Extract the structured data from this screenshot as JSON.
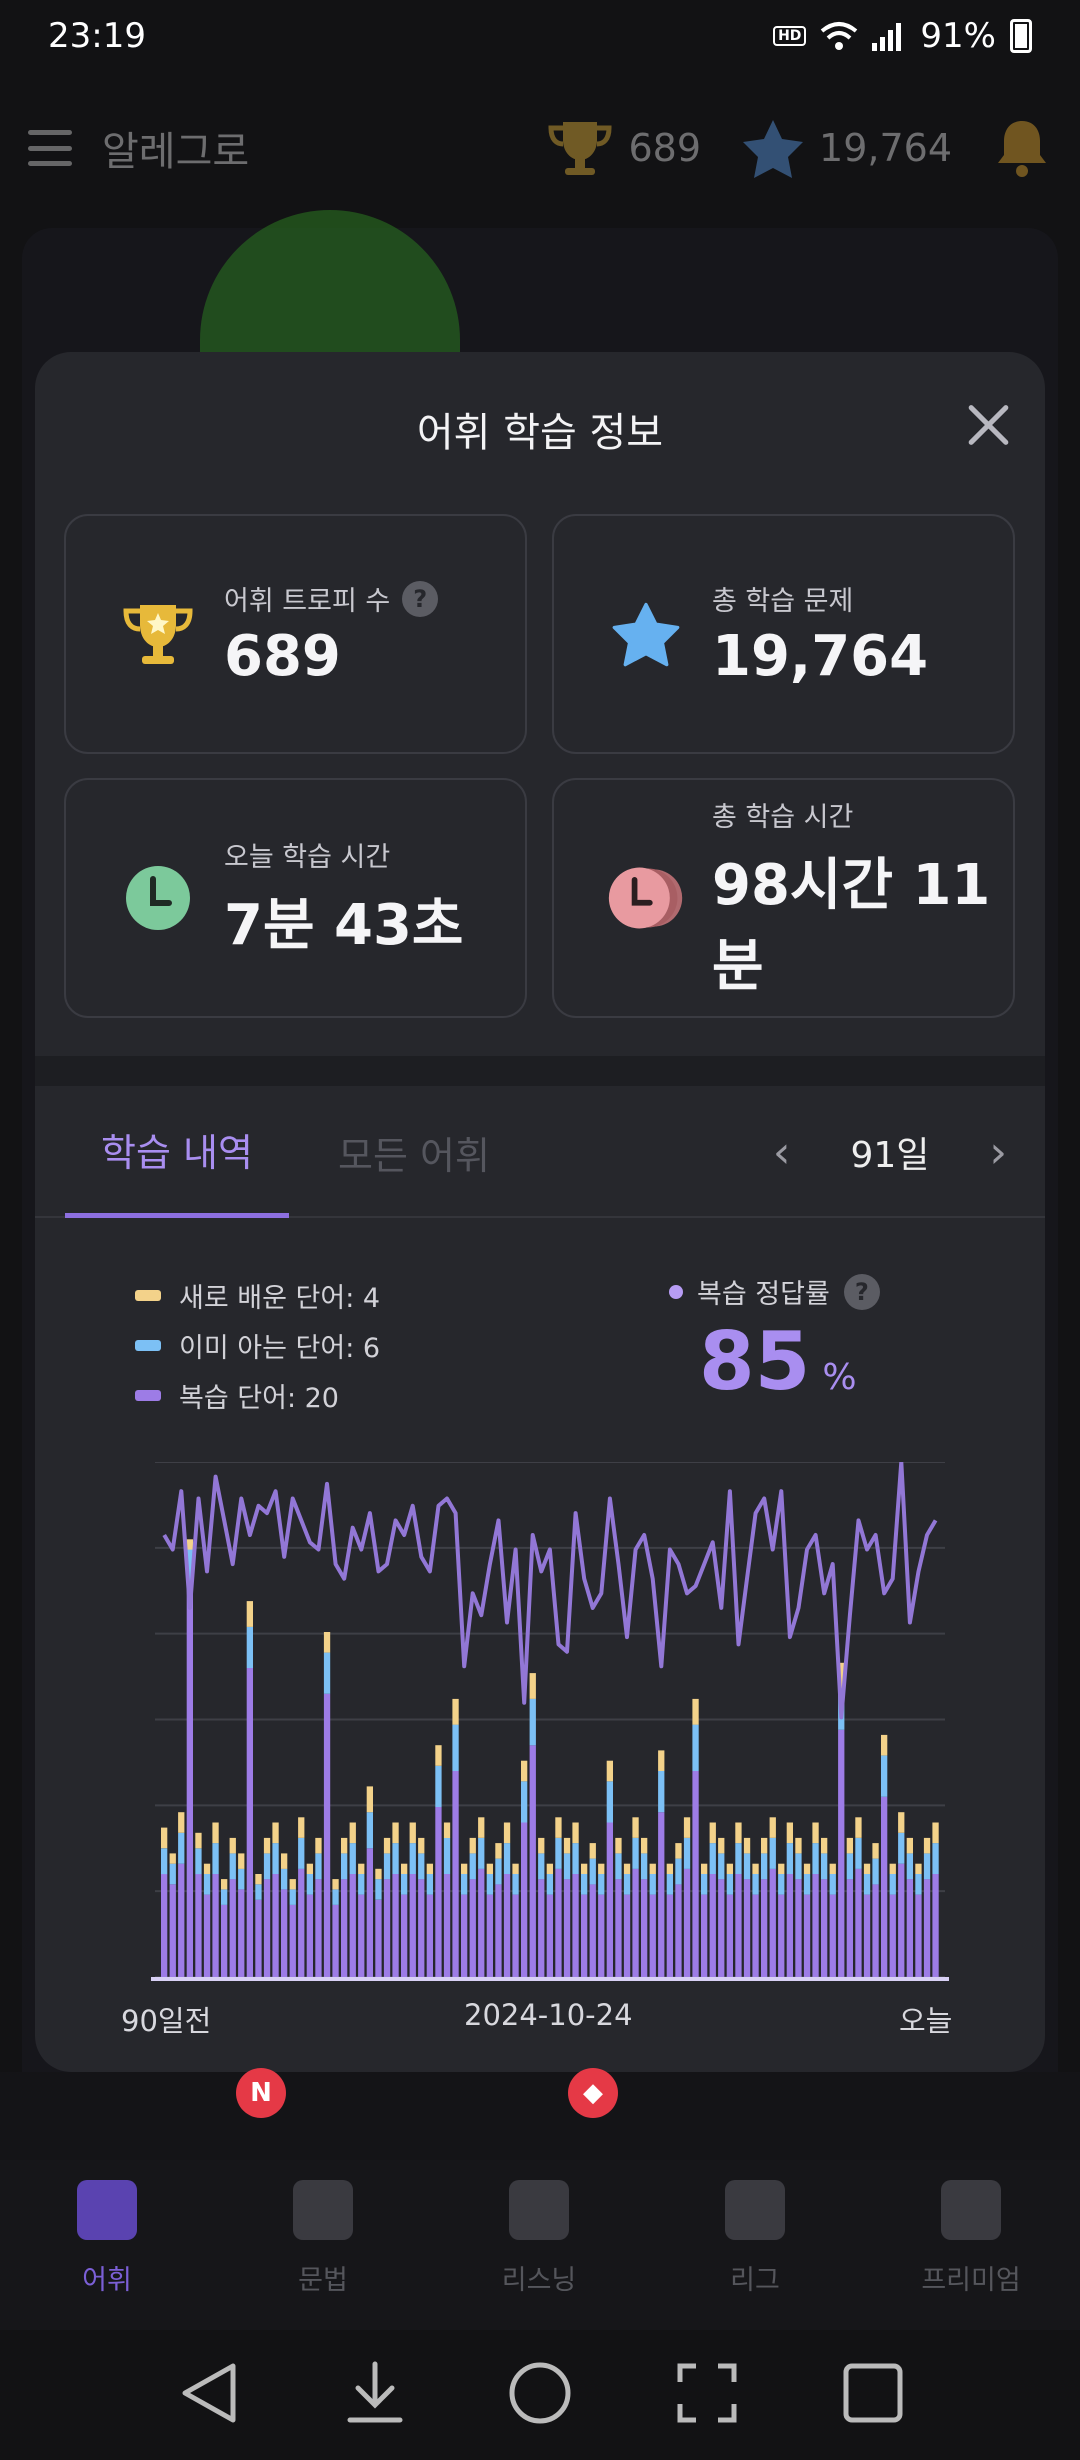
{
  "status_bar": {
    "time": "23:19",
    "hd_label": "HD",
    "battery": "91%"
  },
  "app_bar": {
    "title": "알레그로",
    "trophies": "689",
    "stars": "19,764"
  },
  "modal": {
    "title": "어휘 학습 정보",
    "cards": [
      {
        "label": "어휘 트로피 수",
        "value": "689",
        "icon": "trophy-icon",
        "help": "?"
      },
      {
        "label": "총 학습 문제",
        "value": "19,764",
        "icon": "star-icon"
      },
      {
        "label": "오늘 학습 시간",
        "value": "7분 43초",
        "icon": "clock-icon"
      },
      {
        "label": "총 학습 시간",
        "value": "98시간 11분",
        "icon": "stacked-clock-icon"
      }
    ],
    "tabs": [
      {
        "label": "학습 내역",
        "active": true
      },
      {
        "label": "모든 어휘",
        "active": false
      }
    ],
    "range_label": "91일",
    "legend": [
      {
        "label": "새로 배운 단어: 4",
        "color": "#f3d28a"
      },
      {
        "label": "이미 아는 단어: 6",
        "color": "#7cc0f5"
      },
      {
        "label": "복습 단어: 20",
        "color": "#9d7ce6"
      }
    ],
    "rate": {
      "label": "복습 정답률",
      "help": "?",
      "value": "85",
      "unit": "%"
    }
  },
  "chart_data": {
    "type": "bar",
    "x_labels": [
      "90일전",
      "2024-10-24",
      "오늘"
    ],
    "series": [
      {
        "name": "새로 배운 단어",
        "color": "#f3d28a",
        "values": [
          4,
          2,
          4,
          2,
          3,
          2,
          4,
          2,
          3,
          3,
          5,
          2,
          3,
          4,
          3,
          2,
          4,
          2,
          3,
          4,
          2,
          3,
          4,
          2,
          5,
          2,
          3,
          4,
          2,
          4,
          3,
          2,
          4,
          3,
          5,
          2,
          3,
          4,
          2,
          3,
          4,
          2,
          4,
          5,
          3,
          2,
          4,
          3,
          4,
          2,
          3,
          2,
          4,
          3,
          2,
          4,
          3,
          2,
          4,
          2,
          3,
          4,
          5,
          2,
          4,
          3,
          2,
          4,
          3,
          2,
          3,
          4,
          2,
          4,
          3,
          2,
          4,
          3,
          2,
          5,
          3,
          4,
          2,
          3,
          4,
          2,
          4,
          3,
          2,
          3,
          4
        ]
      },
      {
        "name": "이미 아는 단어",
        "color": "#7cc0f5",
        "values": [
          5,
          4,
          6,
          8,
          5,
          4,
          6,
          3,
          5,
          4,
          8,
          3,
          5,
          6,
          4,
          3,
          6,
          4,
          5,
          8,
          3,
          5,
          6,
          4,
          7,
          4,
          5,
          6,
          4,
          6,
          5,
          4,
          8,
          7,
          9,
          4,
          5,
          6,
          4,
          5,
          6,
          4,
          8,
          9,
          5,
          4,
          6,
          5,
          6,
          4,
          5,
          4,
          8,
          5,
          4,
          6,
          5,
          4,
          8,
          4,
          5,
          6,
          9,
          4,
          6,
          5,
          4,
          6,
          5,
          4,
          5,
          6,
          4,
          6,
          5,
          4,
          6,
          5,
          4,
          8,
          5,
          6,
          4,
          5,
          8,
          4,
          6,
          5,
          4,
          5,
          6
        ]
      },
      {
        "name": "복습 단어",
        "color": "#9d7ce6",
        "values": [
          20,
          18,
          22,
          75,
          20,
          16,
          20,
          14,
          19,
          17,
          60,
          15,
          19,
          20,
          17,
          14,
          21,
          16,
          19,
          55,
          14,
          19,
          20,
          16,
          25,
          15,
          19,
          20,
          16,
          20,
          19,
          16,
          33,
          20,
          40,
          16,
          19,
          21,
          16,
          18,
          20,
          16,
          30,
          45,
          19,
          16,
          21,
          19,
          20,
          16,
          18,
          16,
          30,
          19,
          16,
          21,
          19,
          16,
          32,
          16,
          18,
          21,
          40,
          16,
          20,
          19,
          16,
          20,
          19,
          16,
          19,
          21,
          16,
          20,
          19,
          16,
          20,
          19,
          16,
          48,
          19,
          21,
          16,
          18,
          35,
          16,
          22,
          19,
          16,
          19,
          20
        ]
      }
    ],
    "line": {
      "name": "복습 정답률",
      "color": "#9277d6",
      "ylim": [
        40,
        100
      ],
      "values": [
        90,
        88,
        96,
        80,
        95,
        85,
        98,
        92,
        86,
        95,
        90,
        94,
        93,
        96,
        87,
        95,
        92,
        89,
        88,
        97,
        86,
        84,
        91,
        88,
        93,
        85,
        86,
        92,
        90,
        94,
        87,
        85,
        94,
        95,
        93,
        72,
        82,
        79,
        86,
        92,
        78,
        88,
        67,
        90,
        85,
        88,
        75,
        74,
        93,
        84,
        80,
        82,
        95,
        86,
        76,
        88,
        90,
        84,
        72,
        88,
        86,
        82,
        83,
        86,
        89,
        80,
        96,
        75,
        84,
        93,
        95,
        88,
        96,
        76,
        80,
        88,
        90,
        82,
        86,
        65,
        79,
        92,
        88,
        90,
        82,
        84,
        100,
        78,
        85,
        90,
        92
      ]
    },
    "ylim": [
      0,
      100
    ],
    "grid": true
  },
  "bottom_nav": [
    {
      "label": "어휘",
      "active": true
    },
    {
      "label": "문법",
      "active": false
    },
    {
      "label": "리스닝",
      "active": false
    },
    {
      "label": "리그",
      "active": false
    },
    {
      "label": "프리미엄",
      "active": false
    }
  ],
  "badges": {
    "first": "N"
  }
}
